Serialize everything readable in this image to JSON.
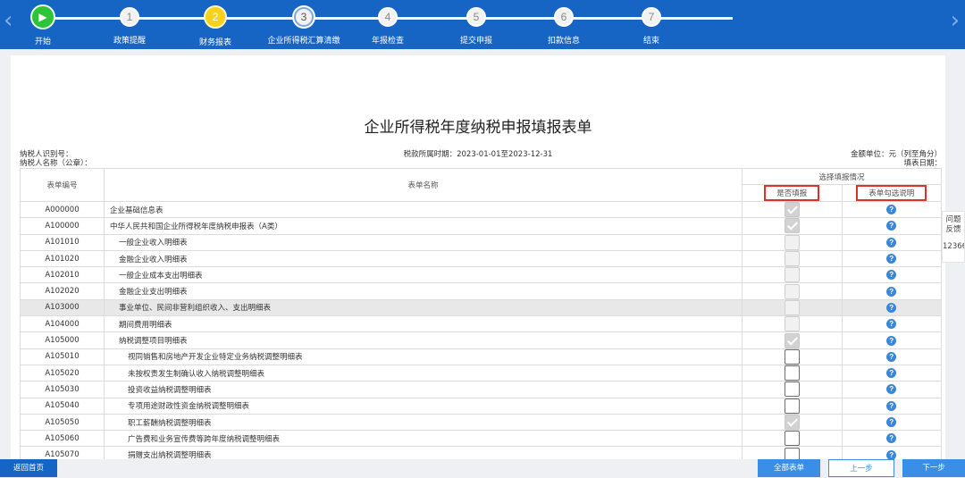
{
  "nav": {
    "prev_arrow": "‹",
    "next_arrow": "›"
  },
  "steps": [
    {
      "num": "",
      "label": "开始",
      "state": "start"
    },
    {
      "num": "1",
      "label": "政策提醒",
      "state": "todo"
    },
    {
      "num": "2",
      "label": "财务报表",
      "state": "done"
    },
    {
      "num": "3",
      "label": "企业所得税汇算清缴",
      "state": "current"
    },
    {
      "num": "4",
      "label": "年报检查",
      "state": "todo"
    },
    {
      "num": "5",
      "label": "提交申报",
      "state": "todo"
    },
    {
      "num": "6",
      "label": "扣款信息",
      "state": "todo"
    },
    {
      "num": "7",
      "label": "结束",
      "state": "todo"
    }
  ],
  "form": {
    "title": "企业所得税年度纳税申报填报表单",
    "taxpayer_id_label": "纳税人识别号：",
    "taxpayer_name_label": "纳税人名称（公章）：",
    "period": "税款所属时期：2023-01-01至2023-12-31",
    "unit": "金额单位：元（列至角分）",
    "fill_date_label": "填表日期："
  },
  "table": {
    "headers": {
      "code": "表单编号",
      "name": "表单名称",
      "select_group": "选择填报情况",
      "fill": "是否填报",
      "help": "表单勾选说明"
    },
    "rows": [
      {
        "code": "A000000",
        "name": "企业基础信息表",
        "level": 0,
        "fill": "checked-disabled",
        "highlight": false
      },
      {
        "code": "A100000",
        "name": "中华人民共和国企业所得税年度纳税申报表（A类）",
        "level": 0,
        "fill": "checked-disabled",
        "highlight": false
      },
      {
        "code": "A101010",
        "name": "一般企业收入明细表",
        "level": 1,
        "fill": "disabled",
        "highlight": false
      },
      {
        "code": "A101020",
        "name": "金融企业收入明细表",
        "level": 1,
        "fill": "disabled",
        "highlight": false
      },
      {
        "code": "A102010",
        "name": "一般企业成本支出明细表",
        "level": 1,
        "fill": "disabled",
        "highlight": false
      },
      {
        "code": "A102020",
        "name": "金融企业支出明细表",
        "level": 1,
        "fill": "disabled",
        "highlight": false
      },
      {
        "code": "A103000",
        "name": "事业单位、民间非营利组织收入、支出明细表",
        "level": 1,
        "fill": "disabled",
        "highlight": true
      },
      {
        "code": "A104000",
        "name": "期间费用明细表",
        "level": 1,
        "fill": "disabled",
        "highlight": false
      },
      {
        "code": "A105000",
        "name": "纳税调整项目明细表",
        "level": 1,
        "fill": "checked-disabled",
        "highlight": false
      },
      {
        "code": "A105010",
        "name": "视同销售和房地产开发企业特定业务纳税调整明细表",
        "level": 2,
        "fill": "empty",
        "highlight": false
      },
      {
        "code": "A105020",
        "name": "未按权责发生制确认收入纳税调整明细表",
        "level": 2,
        "fill": "empty",
        "highlight": false
      },
      {
        "code": "A105030",
        "name": "投资收益纳税调整明细表",
        "level": 2,
        "fill": "empty",
        "highlight": false
      },
      {
        "code": "A105040",
        "name": "专项用途财政性资金纳税调整明细表",
        "level": 2,
        "fill": "empty",
        "highlight": false
      },
      {
        "code": "A105050",
        "name": "职工薪酬纳税调整明细表",
        "level": 2,
        "fill": "checked-disabled",
        "highlight": false
      },
      {
        "code": "A105060",
        "name": "广告费和业务宣传费等跨年度纳税调整明细表",
        "level": 2,
        "fill": "empty",
        "highlight": false
      },
      {
        "code": "A105070",
        "name": "捐赠支出纳税调整明细表",
        "level": 2,
        "fill": "empty",
        "highlight": false
      }
    ],
    "help_icon": "?"
  },
  "feedback": {
    "line1": "问题",
    "line2": "反馈",
    "line3": "12366"
  },
  "buttons": {
    "home": "返回首页",
    "all_forms": "全部表单",
    "prev": "上一步",
    "next": "下一步"
  },
  "colors": {
    "primary": "#1665c4",
    "accent": "#3a8ee6",
    "start_green": "#2ec43a",
    "done_yellow": "#f5d21f",
    "highlight_red": "#e0322a"
  }
}
